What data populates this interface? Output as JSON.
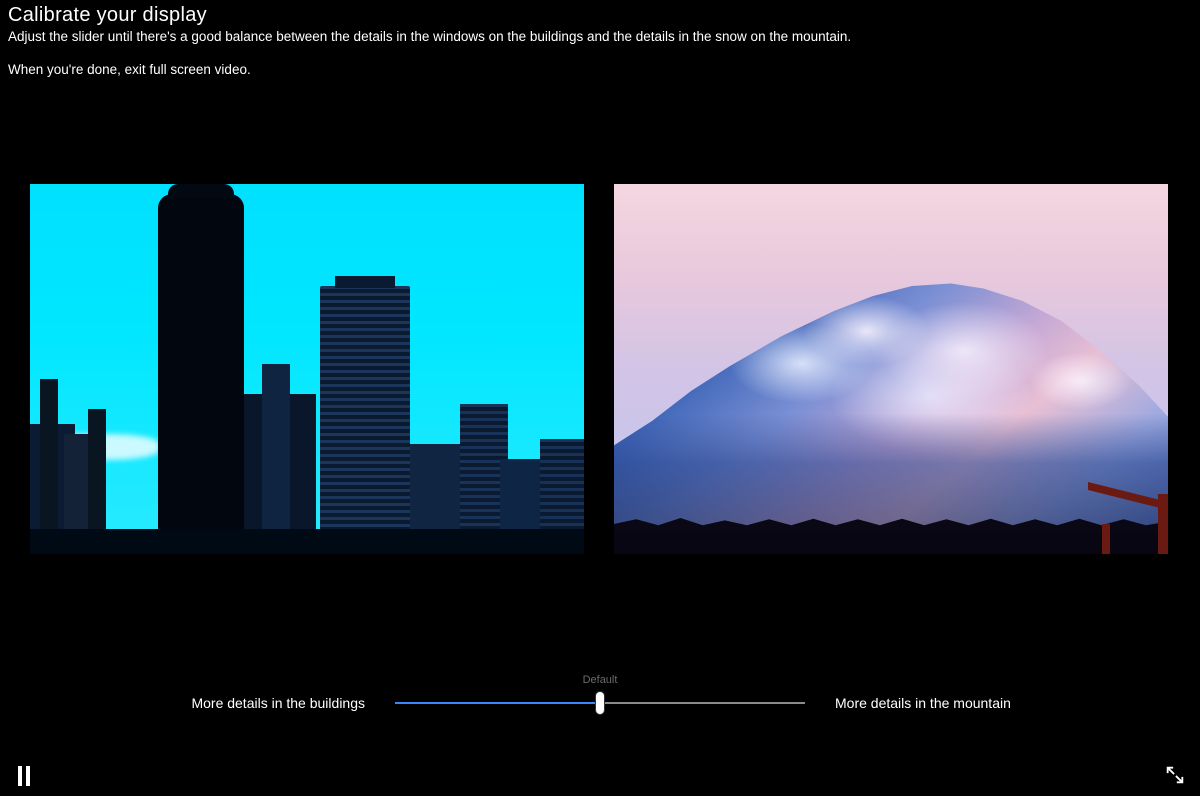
{
  "header": {
    "title": "Calibrate your display",
    "instruction": "Adjust the slider until there's a good balance between the details in the windows on the buildings and the details in the snow on the mountain.",
    "exit_hint": "When you're done, exit full screen video."
  },
  "previews": {
    "left_alt": "City skyline with dark buildings against a bright cyan sky",
    "right_alt": "Snow-covered mountain at dusk with pink and blue tones"
  },
  "slider": {
    "left_label": "More details in the buildings",
    "right_label": "More details in the mountain",
    "center_label": "Default",
    "value_percent": 50
  },
  "controls": {
    "pause_name": "pause-icon",
    "exit_fullscreen_name": "exit-fullscreen-icon"
  }
}
